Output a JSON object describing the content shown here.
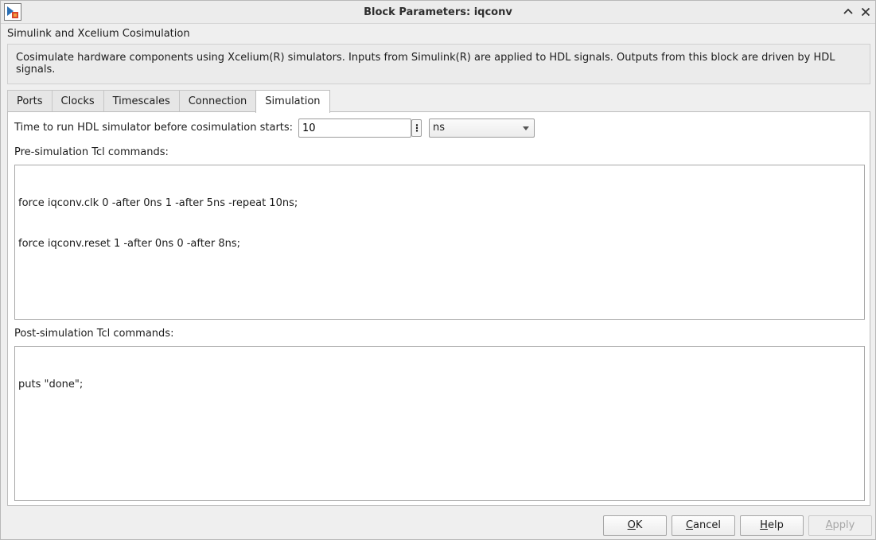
{
  "window": {
    "title": "Block Parameters: iqconv",
    "app_icon": "simulink-block-icon",
    "minimize_icon": "chevron-up-icon",
    "close_icon": "close-icon"
  },
  "block": {
    "name": "Simulink and Xcelium Cosimulation",
    "description": "Cosimulate hardware components using Xcelium(R) simulators.  Inputs from Simulink(R) are applied to HDL signals.  Outputs from this block are driven by HDL signals."
  },
  "tabs": [
    {
      "label": "Ports",
      "active": false
    },
    {
      "label": "Clocks",
      "active": false
    },
    {
      "label": "Timescales",
      "active": false
    },
    {
      "label": "Connection",
      "active": false
    },
    {
      "label": "Simulation",
      "active": true
    }
  ],
  "simulation": {
    "time_label": "Time to run HDL simulator before cosimulation starts:",
    "time_value": "10",
    "more_glyph": "⋮",
    "time_unit": "ns",
    "pre_label": "Pre-simulation Tcl commands:",
    "pre_commands": [
      "force iqconv.clk 0 -after 0ns 1 -after 5ns -repeat 10ns;",
      "force iqconv.reset 1 -after 0ns 0 -after 8ns;"
    ],
    "post_label": "Post-simulation Tcl commands:",
    "post_commands": [
      "puts \"done\";"
    ]
  },
  "buttons": {
    "ok": {
      "pre": "",
      "acc": "O",
      "post": "K",
      "enabled": true
    },
    "cancel": {
      "pre": "",
      "acc": "C",
      "post": "ancel",
      "enabled": true
    },
    "help": {
      "pre": "",
      "acc": "H",
      "post": "elp",
      "enabled": true
    },
    "apply": {
      "pre": "",
      "acc": "A",
      "post": "pply",
      "enabled": false
    }
  }
}
